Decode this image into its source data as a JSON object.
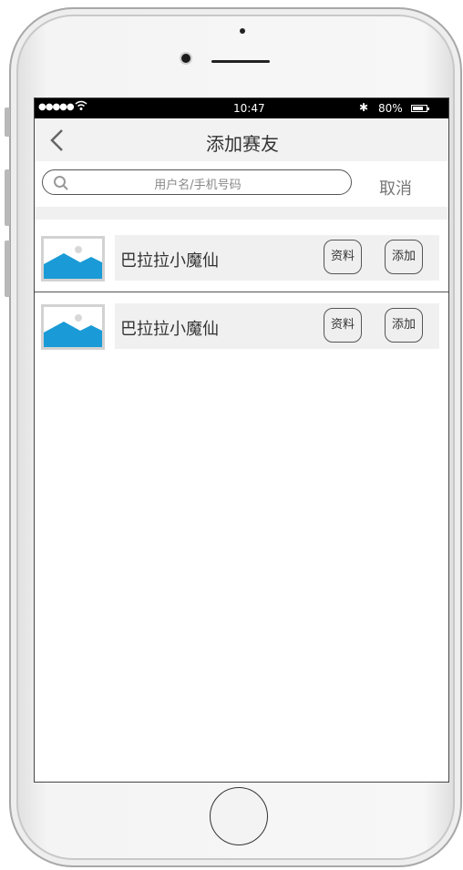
{
  "status_bar": {
    "signal": "●●●●●",
    "time": "10:47",
    "bluetooth": "✱",
    "battery_percent": "80%",
    "battery_level": 0.8
  },
  "nav": {
    "title": "添加赛友",
    "back_icon": "chevron-left-icon"
  },
  "search": {
    "placeholder": "用户名/手机号码",
    "icon": "search-icon",
    "cancel_label": "取消"
  },
  "friends": [
    {
      "name": "巴拉拉小魔仙",
      "info_label": "资料",
      "add_label": "添加",
      "avatar_icon": "image-placeholder-icon"
    },
    {
      "name": "巴拉拉小魔仙",
      "info_label": "资料",
      "add_label": "添加",
      "avatar_icon": "image-placeholder-icon"
    }
  ],
  "colors": {
    "avatar_mountain": "#1a9bd7",
    "status_bar_bg": "#000000",
    "nav_bg": "#f2f2f2",
    "row_bg": "#f0f0f0"
  }
}
